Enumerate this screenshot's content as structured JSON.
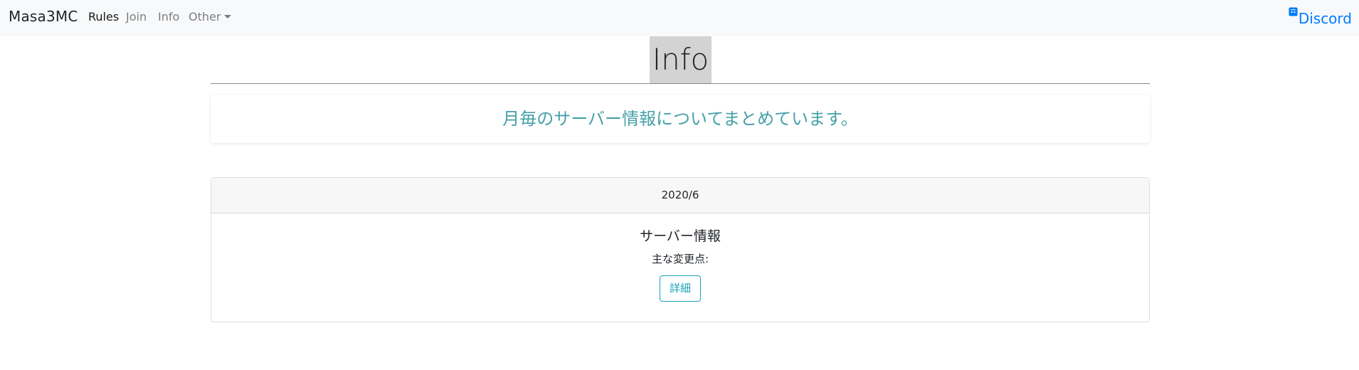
{
  "navbar": {
    "brand": "Masa3MC",
    "links": [
      {
        "label": "Rules",
        "active": true
      },
      {
        "label": "Join",
        "active": false
      },
      {
        "label": "Info",
        "active": false
      },
      {
        "label": "Other",
        "active": false,
        "dropdown": true
      }
    ],
    "discord": {
      "label": "Discord",
      "icon": "discord-icon"
    }
  },
  "page": {
    "title": "Info",
    "lead": "月毎のサーバー情報についてまとめています。"
  },
  "cards": [
    {
      "header": "2020/6",
      "title": "サーバー情報",
      "text": "主な変更点:",
      "button": "詳細"
    }
  ],
  "colors": {
    "navbar_bg": "#f8f9fa",
    "discord": "#007bff",
    "lead": "#45a0a8",
    "button_outline": "#17a2b8",
    "title_bg": "#d3d3d3"
  }
}
